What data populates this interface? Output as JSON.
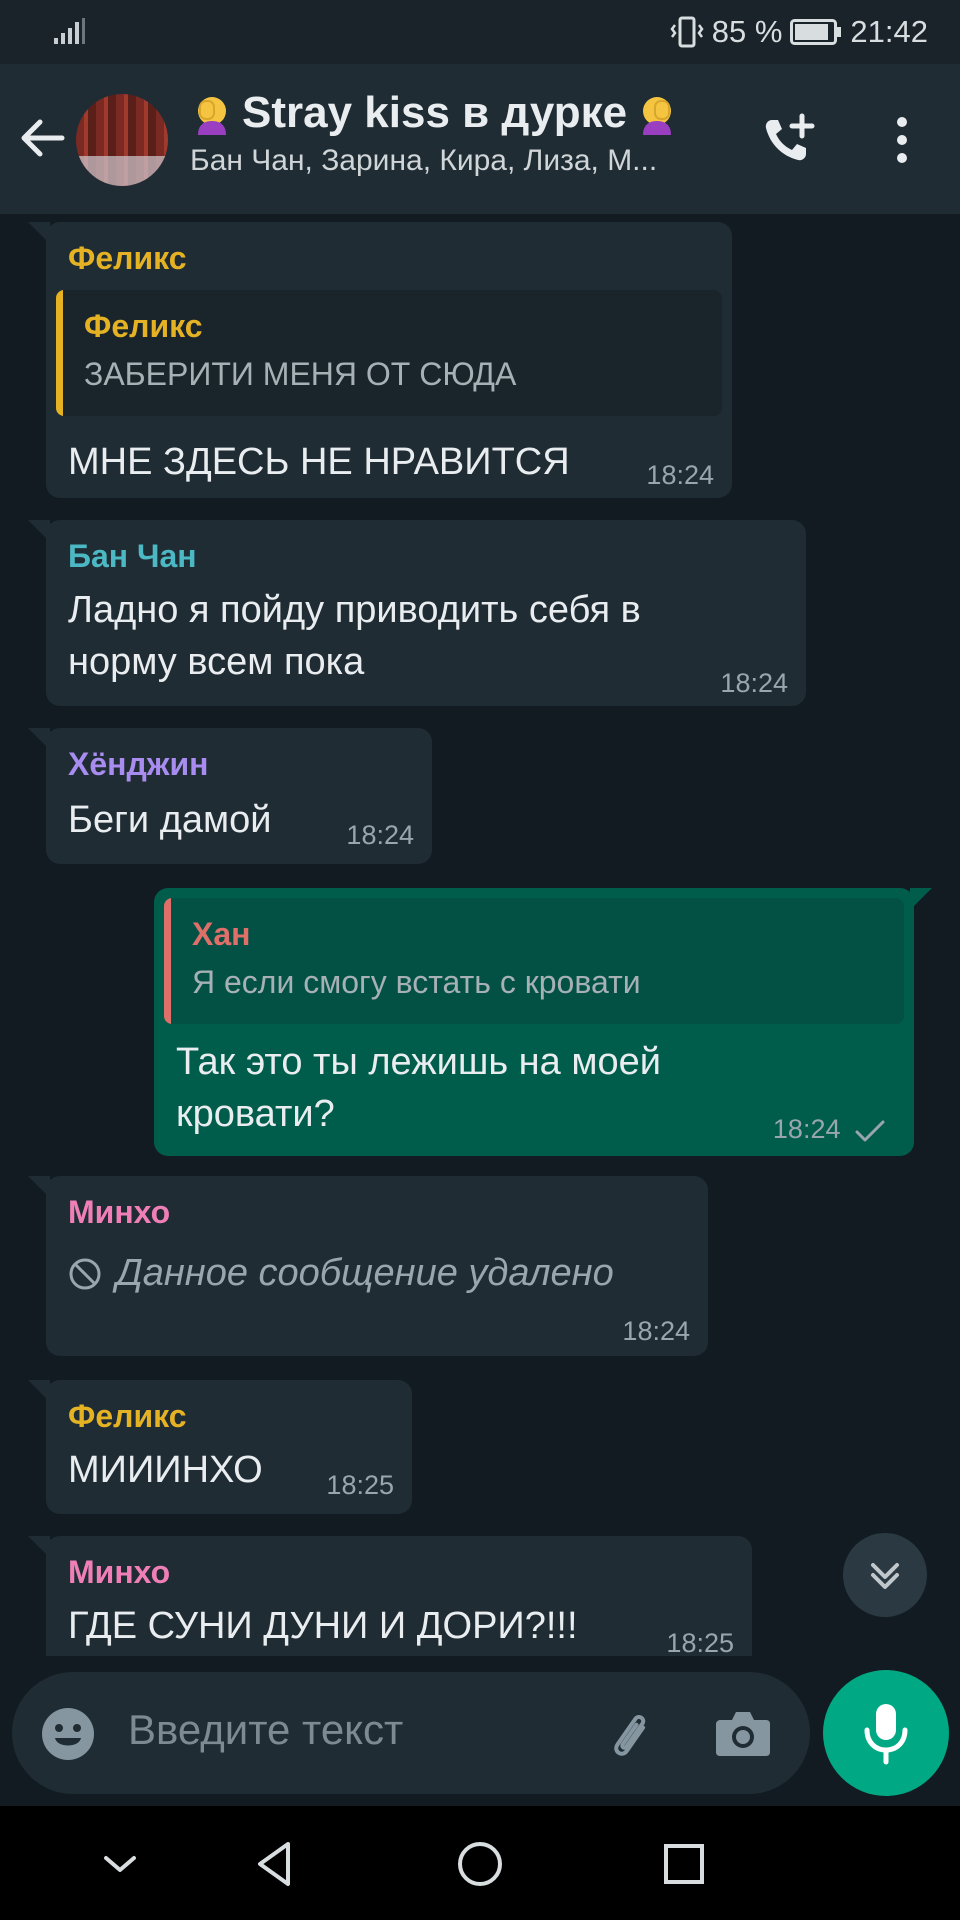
{
  "status_bar": {
    "battery": "85 %",
    "time": "21:42"
  },
  "header": {
    "title": "Stray kiss в дурке",
    "subtitle": "Бан Чан, Зарина, Кира, Лиза, М..."
  },
  "messages": [
    {
      "sender": "Феликс",
      "quote_sender": "Феликс",
      "quote_text": "ЗАБЕРИТИ МЕНЯ ОТ СЮДА",
      "text": "МНЕ ЗДЕСЬ НЕ НРАВИТСЯ",
      "time": "18:24"
    },
    {
      "sender": "Бан Чан",
      "text_line1": "Ладно я пойду приводить себя в",
      "text_line2": "норму всем пока",
      "time": "18:24"
    },
    {
      "sender": "Хёнджин",
      "text": "Беги дамой",
      "time": "18:24"
    },
    {
      "quote_sender": "Хан",
      "quote_text": "Я если смогу встать с кровати",
      "text_line1": "Так это ты лежишь на моей",
      "text_line2": "кровати?",
      "time": "18:24"
    },
    {
      "sender": "Минхо",
      "text": "Данное сообщение удалено",
      "time": "18:24"
    },
    {
      "sender": "Феликс",
      "text": "МИИИНХО",
      "time": "18:25"
    },
    {
      "sender": "Минхо",
      "text": "ГДЕ СУНИ ДУНИ И ДОРИ?!!!",
      "time": "18:25"
    }
  ],
  "input": {
    "placeholder": "Введите текст"
  },
  "colors": {
    "felix": "#e5b224",
    "ban_chan": "#4cb8c4",
    "hyunjin": "#a98cf0",
    "han": "#e06f6a",
    "minho": "#f07fb8",
    "accent": "#00a884"
  },
  "icons": [
    "signal-icon",
    "vibrate-icon",
    "battery-icon",
    "back-arrow-icon",
    "face-palm-emoji-icon",
    "add-call-icon",
    "more-vert-icon",
    "blocked-icon",
    "double-check-icon",
    "chevrons-down-icon",
    "emoji-icon",
    "paperclip-icon",
    "camera-icon",
    "microphone-icon",
    "nav-down-icon",
    "nav-back-icon",
    "nav-home-icon",
    "nav-recents-icon"
  ]
}
